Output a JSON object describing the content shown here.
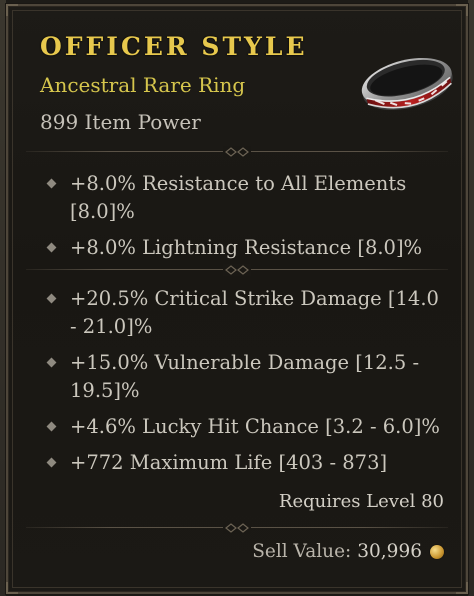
{
  "item": {
    "name": "Officer Style",
    "type": "Ancestral Rare Ring",
    "power": "899 Item Power",
    "icon": "ring-icon"
  },
  "implicit_affixes": [
    {
      "text": "+8.0% Resistance to All Elements [8.0]%"
    },
    {
      "text": "+8.0% Lightning Resistance [8.0]%"
    }
  ],
  "affixes": [
    {
      "text": "+20.5% Critical Strike Damage [14.0 - 21.0]%"
    },
    {
      "text": "+15.0% Vulnerable Damage [12.5 - 19.5]%"
    },
    {
      "text": "+4.6% Lucky Hit Chance [3.2 - 6.0]%"
    },
    {
      "text": "+772 Maximum Life [403 - 873]"
    }
  ],
  "requirements": {
    "level": "Requires Level 80"
  },
  "sell": {
    "label": "Sell Value:",
    "value": "30,996",
    "icon": "gold-coin-icon"
  },
  "colors": {
    "name": "#e7c84d",
    "rare_type": "#d6c64d",
    "text": "#cbc7bd",
    "background": "#1b1915"
  }
}
